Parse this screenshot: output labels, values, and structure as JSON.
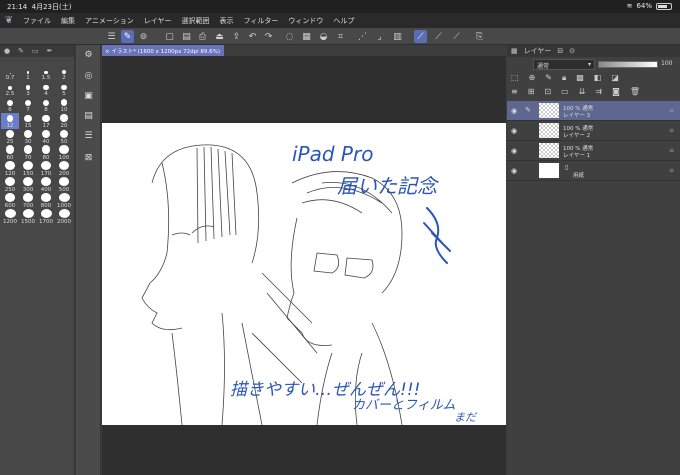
{
  "status": {
    "time": "21:14",
    "date": "4月23日(土)",
    "battery": "64%",
    "battery_level": 0.64
  },
  "menu": [
    "ファイル",
    "編集",
    "アニメーション",
    "レイヤー",
    "選択範囲",
    "表示",
    "フィルター",
    "ウィンドウ",
    "ヘルプ"
  ],
  "brush_sizes": [
    "0.7",
    "1",
    "1.5",
    "2",
    "2.5",
    "3",
    "4",
    "5",
    "6",
    "7",
    "8",
    "10",
    "12",
    "15",
    "17",
    "20",
    "25",
    "30",
    "40",
    "50",
    "60",
    "70",
    "80",
    "100",
    "120",
    "150",
    "170",
    "200",
    "250",
    "300",
    "400",
    "500",
    "600",
    "700",
    "800",
    "1000",
    "1200",
    "1500",
    "1700",
    "2000"
  ],
  "selected_brush_size": "12",
  "document_tab": "イラスト* (1600 x 1200px 72dpi 89.6%)",
  "layer_panel": {
    "tab": "レイヤー",
    "blend_mode": "通常",
    "opacity": "100"
  },
  "layers": [
    {
      "percent": "100 %  通常",
      "name": "レイヤー 3",
      "selected": true
    },
    {
      "percent": "100 %  通常",
      "name": "レイヤー 2",
      "selected": false
    },
    {
      "percent": "100 %  通常",
      "name": "レイヤー 1",
      "selected": false
    },
    {
      "percent": "",
      "name": "用紙",
      "selected": false
    }
  ],
  "artwork_text": {
    "line1": "iPad Pro",
    "line2": "届いた記念",
    "line3": "描きやすい…ぜんぜん!!!",
    "line4": "カバーとフィルム",
    "line5": "まだ"
  },
  "colors": {
    "accent": "#5b6db5",
    "ink_blue": "#2b56b8"
  }
}
